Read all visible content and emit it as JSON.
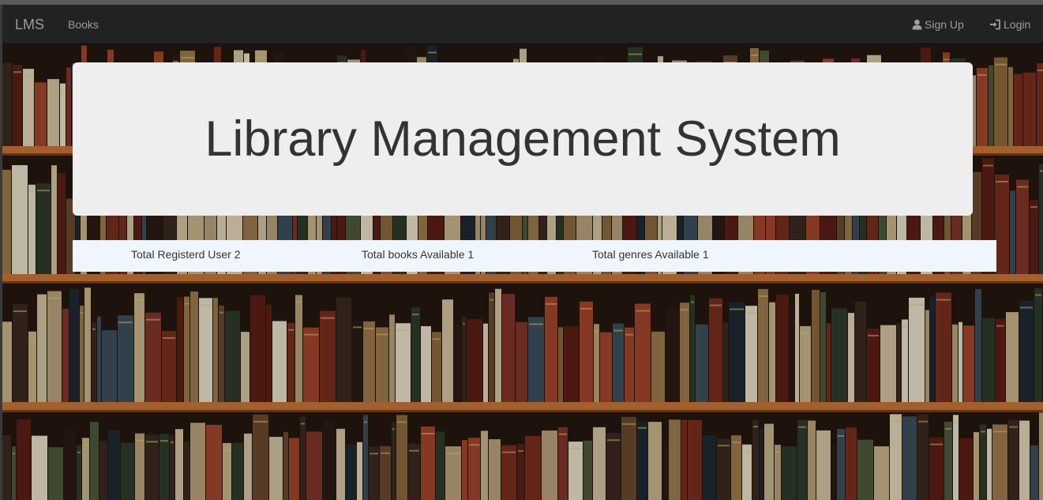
{
  "navbar": {
    "brand": "LMS",
    "links": [
      {
        "label": "Books"
      }
    ],
    "right_links": [
      {
        "label": "Sign Up",
        "icon": "user-icon"
      },
      {
        "label": "Login",
        "icon": "login-icon"
      }
    ]
  },
  "hero": {
    "title": "Library Management System"
  },
  "stats": [
    {
      "text": "Total Registerd User 2"
    },
    {
      "text": "Total books Available 1"
    },
    {
      "text": "Total genres Available 1"
    }
  ],
  "colors": {
    "navbar_bg": "#222222",
    "nav_text": "#9d9d9d",
    "jumbotron_bg": "#eeeeee",
    "stats_bg": "#f0f6fd",
    "shelf_wood": "#c8753a"
  }
}
